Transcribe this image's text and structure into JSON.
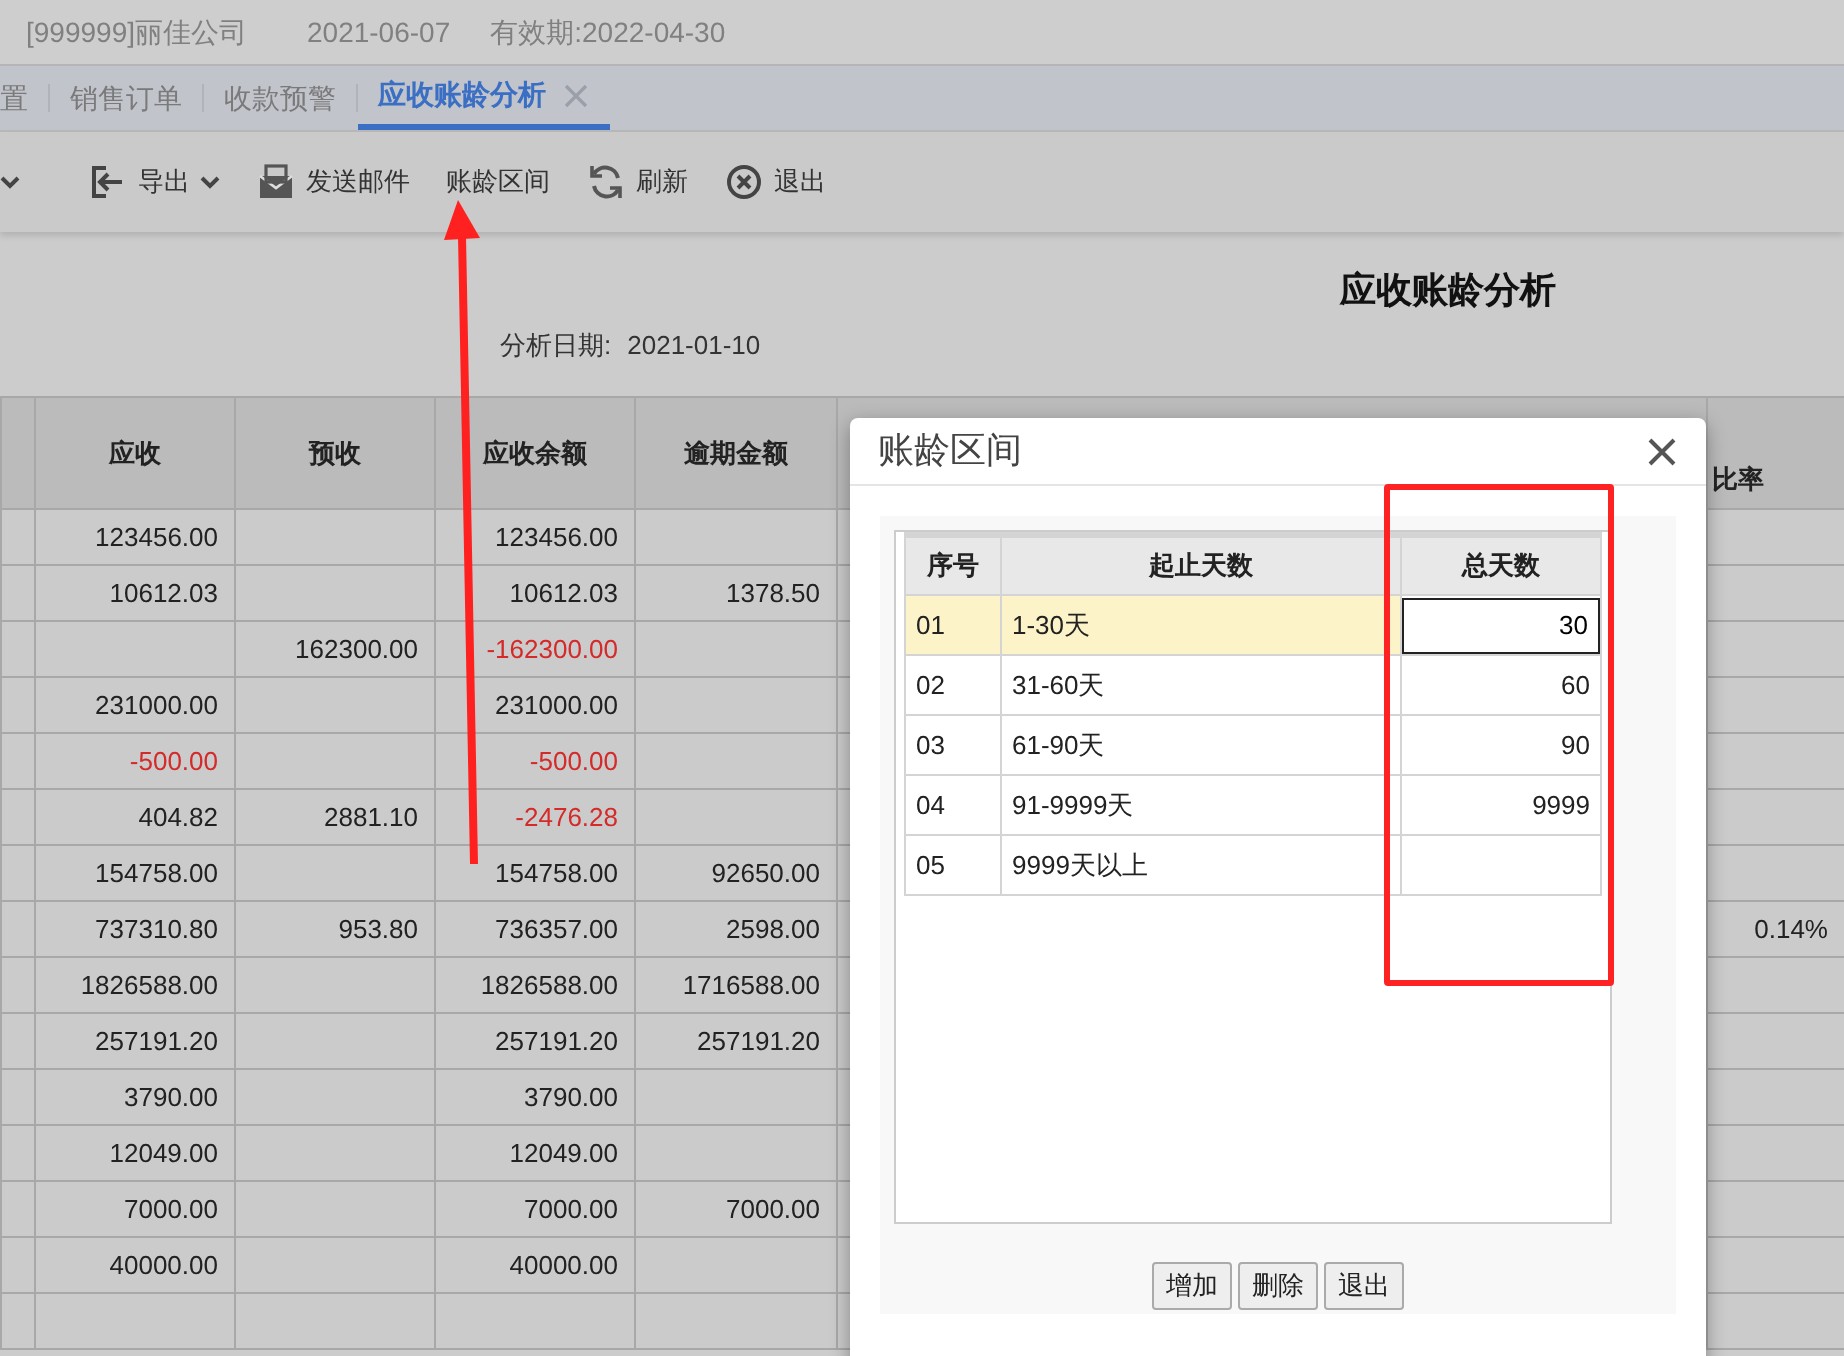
{
  "header": {
    "company": "[999999]丽佳公司",
    "date": "2021-06-07",
    "validity": "有效期:2022-04-30"
  },
  "tabs": [
    {
      "label": "置",
      "selected": false,
      "closable": false
    },
    {
      "label": "销售订单",
      "selected": false,
      "closable": false
    },
    {
      "label": "收款预警",
      "selected": false,
      "closable": false
    },
    {
      "label": "应收账龄分析",
      "selected": true,
      "closable": true
    }
  ],
  "toolbar": [
    {
      "kind": "stub",
      "dropdown": true
    },
    {
      "kind": "export",
      "label": "导出",
      "dropdown": true
    },
    {
      "kind": "mail",
      "label": "发送邮件",
      "dropdown": false
    },
    {
      "kind": "plain",
      "label": "账龄区间",
      "dropdown": false
    },
    {
      "kind": "refresh",
      "label": "刷新",
      "dropdown": false
    },
    {
      "kind": "exit",
      "label": "退出",
      "dropdown": false
    }
  ],
  "report": {
    "title": "应收账龄分析",
    "date_label": "分析日期:",
    "date": "2021-01-10"
  },
  "table": {
    "columns": [
      "应收",
      "预收",
      "应收余额",
      "逾期金额"
    ],
    "ratio_column": "比率",
    "rows": [
      {
        "cells": [
          {
            "text": "123456.00",
            "negative": false
          },
          null,
          {
            "text": "123456.00",
            "negative": false
          },
          null
        ]
      },
      {
        "cells": [
          {
            "text": "10612.03",
            "negative": false
          },
          null,
          {
            "text": "10612.03",
            "negative": false
          },
          {
            "text": "1378.50",
            "negative": false
          }
        ]
      },
      {
        "cells": [
          null,
          {
            "text": "162300.00",
            "negative": false
          },
          {
            "text": "-162300.00",
            "negative": true
          },
          null
        ]
      },
      {
        "cells": [
          {
            "text": "231000.00",
            "negative": false
          },
          null,
          {
            "text": "231000.00",
            "negative": false
          },
          null
        ]
      },
      {
        "cells": [
          {
            "text": "-500.00",
            "negative": true
          },
          null,
          {
            "text": "-500.00",
            "negative": true
          },
          null
        ]
      },
      {
        "cells": [
          {
            "text": "404.82",
            "negative": false
          },
          {
            "text": "2881.10",
            "negative": false
          },
          {
            "text": "-2476.28",
            "negative": true
          },
          null
        ]
      },
      {
        "cells": [
          {
            "text": "154758.00",
            "negative": false
          },
          null,
          {
            "text": "154758.00",
            "negative": false
          },
          {
            "text": "92650.00",
            "negative": false
          }
        ]
      },
      {
        "cells": [
          {
            "text": "737310.80",
            "negative": false
          },
          {
            "text": "953.80",
            "negative": false
          },
          {
            "text": "736357.00",
            "negative": false
          },
          {
            "text": "2598.00",
            "negative": false
          }
        ],
        "ratio": "0.14%"
      },
      {
        "cells": [
          {
            "text": "1826588.00",
            "negative": false
          },
          null,
          {
            "text": "1826588.00",
            "negative": false
          },
          {
            "text": "1716588.00",
            "negative": false
          }
        ]
      },
      {
        "cells": [
          {
            "text": "257191.20",
            "negative": false
          },
          null,
          {
            "text": "257191.20",
            "negative": false
          },
          {
            "text": "257191.20",
            "negative": false
          }
        ]
      },
      {
        "cells": [
          {
            "text": "3790.00",
            "negative": false
          },
          null,
          {
            "text": "3790.00",
            "negative": false
          },
          null
        ]
      },
      {
        "cells": [
          {
            "text": "12049.00",
            "negative": false
          },
          null,
          {
            "text": "12049.00",
            "negative": false
          },
          null
        ]
      },
      {
        "cells": [
          {
            "text": "7000.00",
            "negative": false
          },
          null,
          {
            "text": "7000.00",
            "negative": false
          },
          {
            "text": "7000.00",
            "negative": false
          }
        ]
      },
      {
        "cells": [
          {
            "text": "40000.00",
            "negative": false
          },
          null,
          {
            "text": "40000.00",
            "negative": false
          },
          null
        ]
      },
      {
        "cells": [
          null,
          null,
          null,
          null
        ]
      }
    ]
  },
  "dialog": {
    "title": "账龄区间",
    "columns": [
      "序号",
      "起止天数",
      "总天数"
    ],
    "rows": [
      {
        "no": "01",
        "range": "1-30天",
        "days": "30",
        "selected": true,
        "editing": true
      },
      {
        "no": "02",
        "range": "31-60天",
        "days": "60",
        "selected": false,
        "editing": false
      },
      {
        "no": "03",
        "range": "61-90天",
        "days": "90",
        "selected": false,
        "editing": false
      },
      {
        "no": "04",
        "range": "91-9999天",
        "days": "9999",
        "selected": false,
        "editing": false
      },
      {
        "no": "05",
        "range": "9999天以上",
        "selected": false,
        "editing": false
      }
    ],
    "buttons": [
      "增加",
      "删除",
      "退出"
    ]
  },
  "annotations": {
    "highlight_box": true,
    "arrow": true
  }
}
